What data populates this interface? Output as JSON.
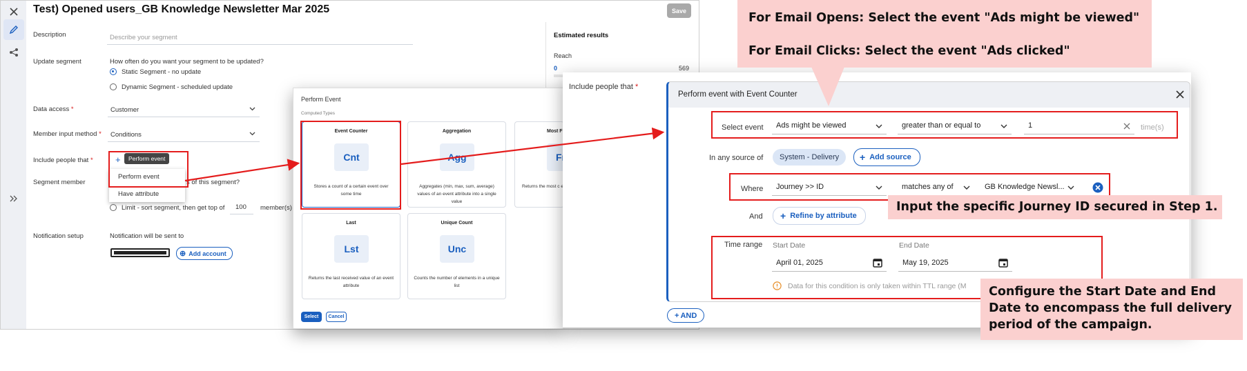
{
  "segment": {
    "title": "Test) Opened users_GB Knowledge Newsletter Mar 2025",
    "save_label": "Save",
    "description_label": "Description",
    "description_placeholder": "Describe your segment",
    "update_label": "Update segment",
    "update_question": "How often do you want your segment to be updated?",
    "update_option_static": "Static Segment - no update",
    "update_option_dynamic": "Dynamic Segment - scheduled update",
    "data_access_label": "Data access",
    "data_access_value": "Customer",
    "member_input_label": "Member input method",
    "member_input_value": "Conditions",
    "include_label": "Include people that",
    "segment_member_label": "Segment member",
    "segment_member_question": "s of this segment?",
    "limit_text": "Limit - sort segment, then get top of",
    "limit_value": "100",
    "limit_unit": "member(s)",
    "notification_label": "Notification setup",
    "notification_text": "Notification will be sent to",
    "add_account_label": "Add account",
    "estimated_title": "Estimated results",
    "reach_label": "Reach",
    "reach_value": "0",
    "reach_total": "569"
  },
  "menu": {
    "tooltip": "Perform event",
    "items": [
      "Perform event",
      "Have attribute"
    ]
  },
  "perform_event_modal": {
    "title": "Perform Event",
    "subtitle": "Computed Types",
    "cards": [
      {
        "title": "Event Counter",
        "abbr": "Cnt",
        "desc": "Stores a count of a certain event over some time"
      },
      {
        "title": "Aggregation",
        "abbr": "Agg",
        "desc": "Aggregates (min, max, sum, average) values of an event attribute into a single value"
      },
      {
        "title": "Most F",
        "abbr": "Fr",
        "desc": "Returns the most c event a"
      },
      {
        "title": "Last",
        "abbr": "Lst",
        "desc": "Returns the last received value of an event attribute"
      },
      {
        "title": "Unique Count",
        "abbr": "Unc",
        "desc": "Counts the number of elements in a unique list"
      }
    ],
    "select_label": "Select",
    "cancel_label": "Cancel"
  },
  "detail": {
    "include_label": "Include people that",
    "box_title": "Perform event with Event Counter",
    "select_event_label": "Select event",
    "event_value": "Ads might be viewed",
    "operator_value": "greater than or equal to",
    "count_value": "1",
    "count_unit": "time(s)",
    "source_label": "In any source of",
    "source_chip": "System - Delivery",
    "add_source_label": "Add source",
    "where_label": "Where",
    "where_attr": "Journey >> ID",
    "where_op": "matches any of",
    "where_value": "GB Knowledge Newsl...",
    "and_label": "And",
    "refine_label": "Refine by attribute",
    "time_range_label": "Time range",
    "start_label": "Start Date",
    "start_value": "April 01, 2025",
    "end_label": "End Date",
    "end_value": "May 19, 2025",
    "ttl_note": "Data for this condition is only taken within TTL range (M",
    "and_button": "AND"
  },
  "callouts": {
    "top_line1": "For Email Opens: Select the event \"Ads might be viewed\"",
    "top_line2": "For Email Clicks: Select the event \"Ads clicked\"",
    "journey": "Input the specific Journey ID secured in Step 1.",
    "dates_line1": "Configure the Start Date and End",
    "dates_line2": "Date to encompass the full delivery",
    "dates_line3": "period of the campaign."
  },
  "colors": {
    "accent": "#1a5fbf",
    "annotation_red": "#e41c1c",
    "callout_bg": "#fbd0cf",
    "required": "#d71a1a"
  }
}
